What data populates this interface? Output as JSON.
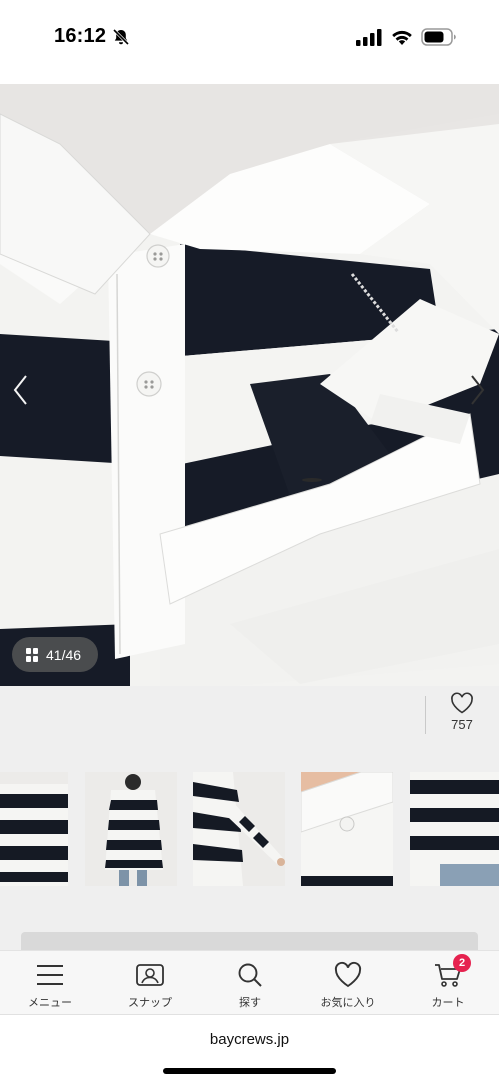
{
  "status_bar": {
    "time": "16:12"
  },
  "gallery": {
    "counter": "41/46",
    "favorite_count": "757"
  },
  "tab_bar": {
    "items": [
      {
        "label": "メニュー",
        "icon": "hamburger-menu-icon"
      },
      {
        "label": "スナップ",
        "icon": "snap-photo-icon"
      },
      {
        "label": "探す",
        "icon": "search-icon"
      },
      {
        "label": "お気に入り",
        "icon": "heart-icon"
      },
      {
        "label": "カート",
        "icon": "cart-icon"
      }
    ],
    "cart_badge": "2"
  },
  "browser": {
    "url": "baycrews.jp"
  },
  "colors": {
    "badge": "#e6224f",
    "stripe_dark": "#161b27",
    "stripe_light": "#f6f6f4"
  }
}
